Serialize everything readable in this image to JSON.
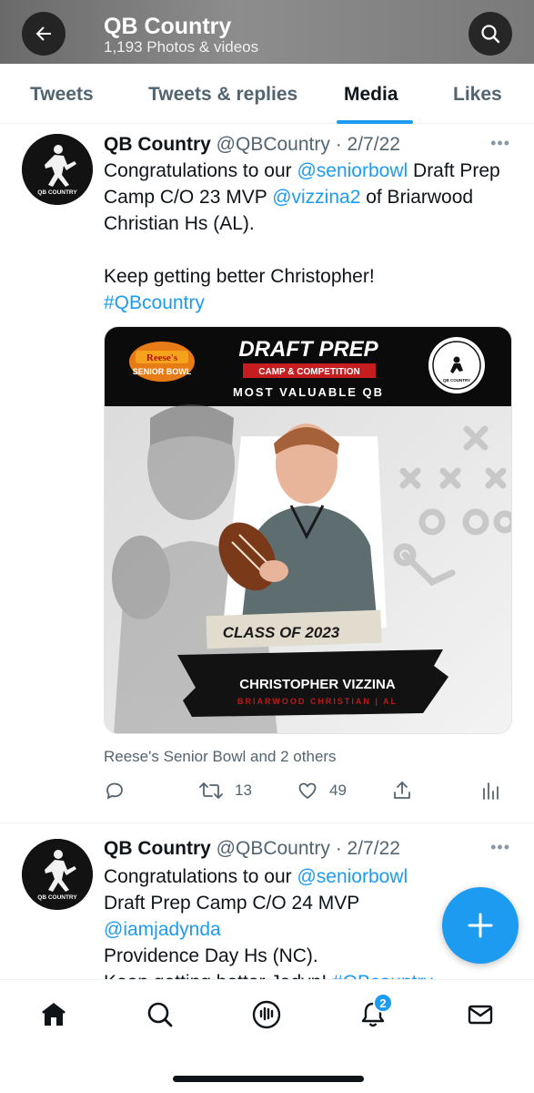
{
  "header": {
    "title": "QB Country",
    "subtitle": "1,193 Photos & videos",
    "back_icon": "arrow-left-icon",
    "search_icon": "search-icon"
  },
  "tabs": [
    {
      "label": "Tweets"
    },
    {
      "label": "Tweets & replies"
    },
    {
      "label": "Media"
    },
    {
      "label": "Likes"
    }
  ],
  "active_tab": "Media",
  "tweets": [
    {
      "name": "QB Country",
      "handle": "@QBCountry",
      "sep": " · ",
      "date": "2/7/22",
      "text_a": "Congratulations to our ",
      "mention_1": "@seniorbowl",
      "text_b": " Draft Prep Camp C/O 23 MVP ",
      "mention_2": "@vizzina2",
      "text_c": " of Briarwood Christian Hs (AL).",
      "text_d": "Keep getting better Christopher!",
      "hashtag": "#QBcountry",
      "tagged": "Reese's Senior Bowl and 2 others",
      "retweets": "13",
      "likes": "49",
      "media": {
        "sponsor_top": "Reese's",
        "sponsor_bottom": "SENIOR BOWL",
        "headline": "DRAFT PREP",
        "ribbon": "CAMP & COMPETITION",
        "subhead": "MOST VALUABLE QB",
        "badge_text": "QB COUNTRY",
        "class_label": "CLASS OF 2023",
        "player_name": "CHRISTOPHER VIZZINA",
        "school": "BRIARWOOD CHRISTIAN | AL"
      }
    },
    {
      "name": "QB Country",
      "handle": "@QBCountry",
      "sep": " · ",
      "date": "2/7/22",
      "text_a": "Congratulations to our ",
      "mention_1": "@seniorbowl",
      "text_b": " Draft Prep Camp C/O 24 MVP ",
      "mention_2": "@iamjadynda",
      "text_c": "Providence Day Hs (NC).",
      "text_d": "Keep getting better Jadyn! ",
      "hashtag": "#QBcountry"
    }
  ],
  "avatar_text": "QB COUNTRY",
  "bottom_nav": {
    "notifications_badge": "2",
    "icons": [
      "home-icon",
      "search-icon",
      "spaces-icon",
      "notifications-icon",
      "messages-icon"
    ]
  },
  "colors": {
    "accent": "#1d9bf0",
    "text": "#0f1419",
    "muted": "#536471"
  }
}
